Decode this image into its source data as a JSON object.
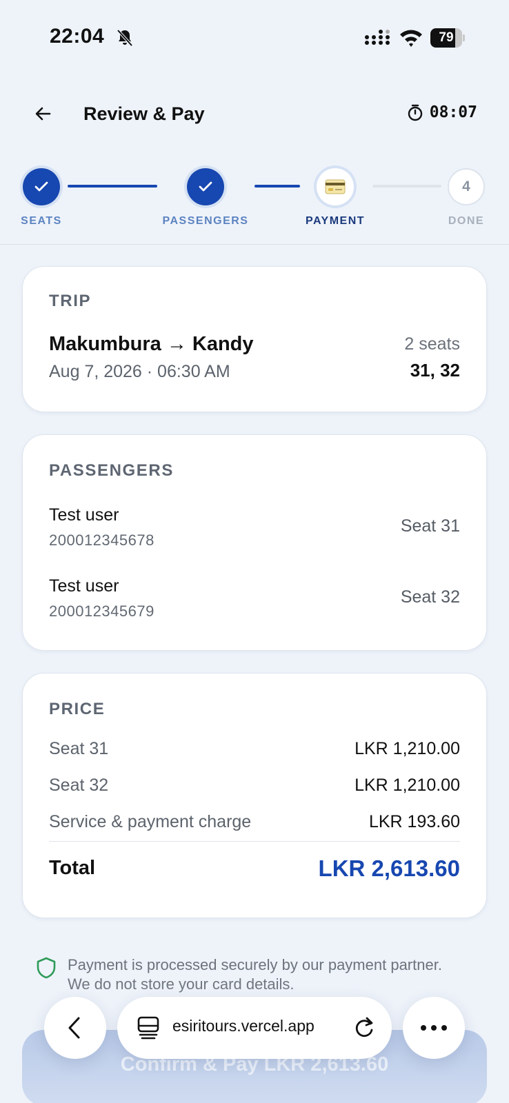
{
  "status_bar": {
    "time": "22:04",
    "battery_level": "79"
  },
  "header": {
    "title": "Review & Pay",
    "timer": "08:07"
  },
  "stepper": {
    "steps": [
      {
        "label": "SEATS",
        "state": "done"
      },
      {
        "label": "PASSENGERS",
        "state": "done"
      },
      {
        "label": "PAYMENT",
        "state": "current"
      },
      {
        "label": "DONE",
        "state": "todo",
        "number": "4"
      }
    ]
  },
  "trip": {
    "title": "TRIP",
    "route": "Makumbura → Kandy",
    "datetime": "Aug 7, 2026 · 06:30 AM",
    "seat_count": "2 seats",
    "seat_numbers": "31, 32"
  },
  "passengers": {
    "title": "PASSENGERS",
    "items": [
      {
        "name": "Test user",
        "id": "200012345678",
        "seat": "Seat 31"
      },
      {
        "name": "Test user",
        "id": "200012345679",
        "seat": "Seat 32"
      }
    ]
  },
  "price": {
    "title": "PRICE",
    "lines": [
      {
        "label": "Seat 31",
        "value": "LKR 1,210.00"
      },
      {
        "label": "Seat 32",
        "value": "LKR 1,210.00"
      },
      {
        "label": "Service & payment charge",
        "value": "LKR 193.60"
      }
    ],
    "total_label": "Total",
    "total_value": "LKR 2,613.60"
  },
  "secure_note": "Payment is processed securely by our payment partner. We do not store your card details.",
  "confirm_button": "Confirm & Pay LKR 2,613.60",
  "browser": {
    "url": "esiritours.vercel.app"
  },
  "colors": {
    "accent": "#1747b0",
    "background": "#eef3fa",
    "secure_green": "#2e9b58"
  }
}
